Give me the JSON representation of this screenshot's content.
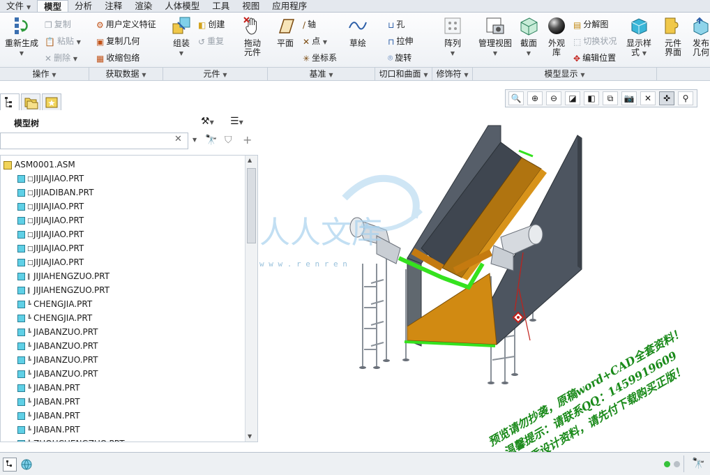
{
  "tabs": [
    "文件",
    "模型",
    "分析",
    "注释",
    "渲染",
    "人体模型",
    "工具",
    "视图",
    "应用程序"
  ],
  "active_tab": "模型",
  "ribbon": {
    "regenerate": "重新生成",
    "copy": "复制",
    "paste": "粘贴",
    "delete": "删除",
    "user_feature": "用户定义特征",
    "copy_geometry": "复制几何",
    "shrinkwrap": "收缩包络",
    "assemble": "组装",
    "create": "创建",
    "repeat": "重复",
    "drag_components_1": "拖动",
    "drag_components_2": "元件",
    "plane": "平面",
    "axis": "轴",
    "point": "点",
    "csys": "坐标系",
    "sketch": "草绘",
    "hole": "孔",
    "extrude": "拉伸",
    "revolve": "旋转",
    "pattern": "阵列",
    "manage_views": "管理视图",
    "section": "截面",
    "appearance_1": "外观",
    "appearance_2": "库",
    "explode": "分解图",
    "toggle_status": "切换状况",
    "edit_position": "编辑位置",
    "display_style_1": "显示样",
    "display_style_2": "式",
    "component_interface_1": "元件",
    "component_interface_2": "界面",
    "publish_geometry_1": "发布",
    "publish_geometry_2": "几何"
  },
  "groups": [
    "操作",
    "获取数据",
    "元件",
    "基准",
    "切口和曲面",
    "修饰符",
    "模型显示"
  ],
  "tree": {
    "title": "模型树",
    "search_value": "",
    "root": "ASM0001.ASM",
    "items": [
      {
        "mark": "□",
        "name": "JIJIAJIAO.PRT"
      },
      {
        "mark": "□",
        "name": "JIJIADIBAN.PRT"
      },
      {
        "mark": "□",
        "name": "JIJIAJIAO.PRT"
      },
      {
        "mark": "□",
        "name": "JIJIAJIAO.PRT"
      },
      {
        "mark": "□",
        "name": "JIJIAJIAO.PRT"
      },
      {
        "mark": "□",
        "name": "JIJIAJIAO.PRT"
      },
      {
        "mark": "□",
        "name": "JIJIAJIAO.PRT"
      },
      {
        "mark": "‖",
        "name": "JIJIAHENGZUO.PRT"
      },
      {
        "mark": "‖",
        "name": "JIJIAHENGZUO.PRT"
      },
      {
        "mark": "╚",
        "name": "CHENGJIA.PRT"
      },
      {
        "mark": "╚",
        "name": "CHENGJIA.PRT"
      },
      {
        "mark": "╚",
        "name": "JIABANZUO.PRT"
      },
      {
        "mark": "╚",
        "name": "JIABANZUO.PRT"
      },
      {
        "mark": "╚",
        "name": "JIABANZUO.PRT"
      },
      {
        "mark": "╚",
        "name": "JIABANZUO.PRT"
      },
      {
        "mark": "╚",
        "name": "JIABAN.PRT"
      },
      {
        "mark": "╚",
        "name": "JIABAN.PRT"
      },
      {
        "mark": "╚",
        "name": "JIABAN.PRT"
      },
      {
        "mark": "╚",
        "name": "JIABAN.PRT"
      },
      {
        "mark": "╚",
        "name": "ZHOUCHENGZUO.PRT"
      }
    ]
  },
  "watermark": {
    "logo_text": "人人文库",
    "url_text": "w w w . r e n r e n",
    "line1": "预览请勿抄袭，原稿word+CAD全套资料！",
    "line2": "温馨提示：请联系QQ：1459919609",
    "line3": "优秀设计资料，请先付下载购买正版！"
  },
  "colors": {
    "ribbon_bg": "#eef1f5",
    "tab_active": "#fbfcfd",
    "frame": "#b8c2ce",
    "part_icon": "#5fd0e6",
    "model_steel": "#4d5560",
    "model_orange": "#d18a12",
    "model_green": "#35e21f",
    "watermark_green": "#1a8a1a",
    "watermark_blue": "#a9d2ee"
  }
}
